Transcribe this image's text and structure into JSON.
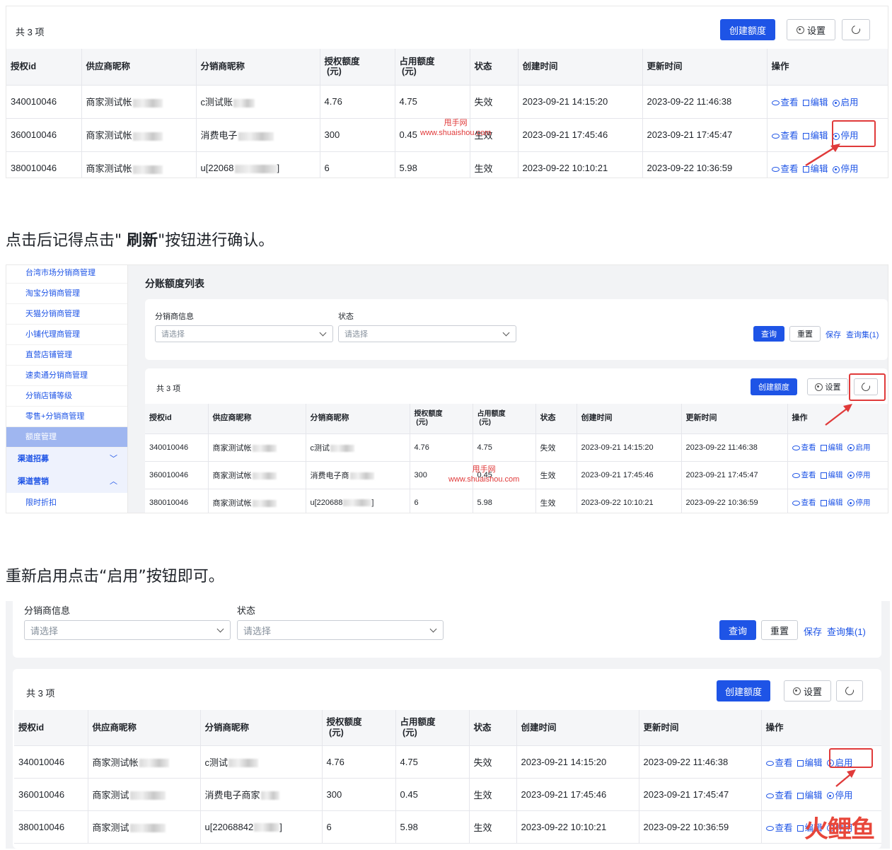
{
  "screens": {
    "common": {
      "total": "共 3 项",
      "create_btn": "创建额度",
      "settings_btn": "设置",
      "columns": [
        "授权id",
        "供应商昵称",
        "分销商昵称",
        "授权额度\n(元)",
        "占用额度\n(元)",
        "状态",
        "创建时间",
        "更新时间",
        "操作"
      ],
      "rows": [
        {
          "id": "340010046",
          "supplier": "商家测试帐号",
          "dist": "c测试账号",
          "auth": "4.76",
          "used": "4.75",
          "status": "失效",
          "created": "2023-09-21 14:15:20",
          "updated": "2023-09-22 11:46:38",
          "toggle": "启用"
        },
        {
          "id": "360010046",
          "supplier": "商家测试帐号",
          "dist": "消费电子商家",
          "auth": "300",
          "used": "0.45",
          "status": "生效",
          "created": "2023-09-21 17:45:46",
          "updated": "2023-09-21 17:45:47",
          "toggle": "停用"
        },
        {
          "id": "380010046",
          "supplier": "商家测试帐号",
          "dist": "u[22068842]",
          "auth": "6",
          "used": "5.98",
          "status": "生效",
          "created": "2023-09-22 10:10:21",
          "updated": "2023-09-22 10:36:59",
          "toggle": "停用"
        }
      ],
      "op_view": "查看",
      "op_edit": "编辑"
    },
    "s1": {
      "dist_names": [
        "c测试账号",
        "消费电子",
        "u[22068"
      ],
      "row3_toggle": "停用",
      "row1_toggle": "启用"
    },
    "s3": {
      "row1_toggle": "启用",
      "row3_toggle": "停用"
    }
  },
  "prose": {
    "p1_pre": "点击后记得点击\" ",
    "p1_bold": "刷新",
    "p1_post": "\"按钮进行确认。",
    "p2": "重新启用点击“启用”按钮即可。"
  },
  "watermark": {
    "line1": "甩手网",
    "line2": "www.shuaishou.com"
  },
  "sidebar": {
    "items": [
      "台湾市场分销商管理",
      "淘宝分销商管理",
      "天猫分销商管理",
      "小铺代理商管理",
      "直营店铺管理",
      "速卖通分销商管理",
      "分销店铺等级",
      "零售+分销商管理",
      "额度管理"
    ],
    "group1": "渠道招募",
    "group2": "渠道营销",
    "sub": "限时折扣"
  },
  "list_page": {
    "title": "分账额度列表",
    "filter_dist_label": "分销商信息",
    "filter_status_label": "状态",
    "select_placeholder": "请选择",
    "query_btn": "查询",
    "reset_btn": "重置",
    "save_link": "保存",
    "queryset_link": "查询集(1)"
  },
  "logo": {
    "text1": "火",
    "text2": "鲤鱼"
  }
}
